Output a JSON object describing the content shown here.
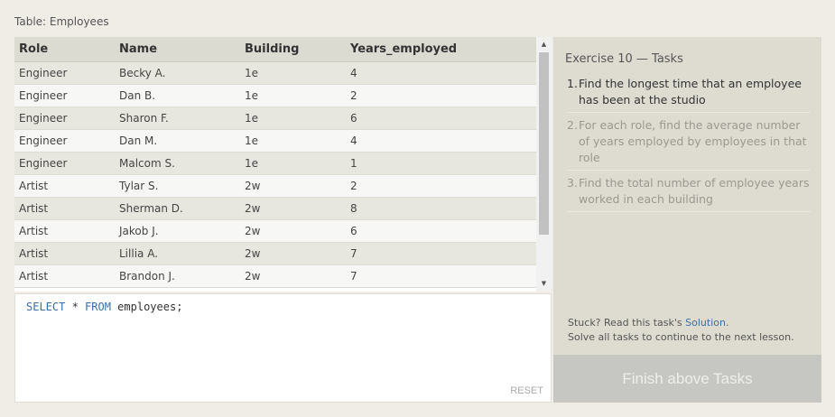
{
  "table": {
    "caption": "Table: Employees",
    "columns": [
      "Role",
      "Name",
      "Building",
      "Years_employed"
    ],
    "rows": [
      [
        "Engineer",
        "Becky A.",
        "1e",
        "4"
      ],
      [
        "Engineer",
        "Dan B.",
        "1e",
        "2"
      ],
      [
        "Engineer",
        "Sharon F.",
        "1e",
        "6"
      ],
      [
        "Engineer",
        "Dan M.",
        "1e",
        "4"
      ],
      [
        "Engineer",
        "Malcom S.",
        "1e",
        "1"
      ],
      [
        "Artist",
        "Tylar S.",
        "2w",
        "2"
      ],
      [
        "Artist",
        "Sherman D.",
        "2w",
        "8"
      ],
      [
        "Artist",
        "Jakob J.",
        "2w",
        "6"
      ],
      [
        "Artist",
        "Lillia A.",
        "2w",
        "7"
      ],
      [
        "Artist",
        "Brandon J.",
        "2w",
        "7"
      ]
    ]
  },
  "editor": {
    "query": {
      "select": "SELECT",
      "star": " * ",
      "from": "FROM",
      "rest": " employees;"
    },
    "reset_label": "RESET"
  },
  "exercise": {
    "title": "Exercise 10 — Tasks",
    "tasks": [
      {
        "num": "1.",
        "text": "Find the longest time that an employee has been at the studio",
        "state": "active"
      },
      {
        "num": "2.",
        "text": "For each role, find the average number of years employed by employees in that role",
        "state": "pending"
      },
      {
        "num": "3.",
        "text": "Find the total number of employee years worked in each building",
        "state": "pending"
      }
    ],
    "stuck_prefix": "Stuck? Read this task's ",
    "solution_label": "Solution",
    "stuck_suffix": ".",
    "continue_note": "Solve all tasks to continue to the next lesson.",
    "finish_label": "Finish above Tasks"
  }
}
